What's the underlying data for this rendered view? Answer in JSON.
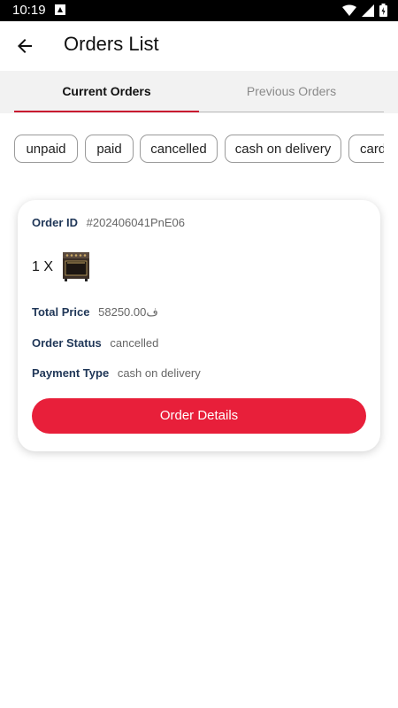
{
  "status_bar": {
    "time": "10:19"
  },
  "header": {
    "title": "Orders List"
  },
  "tabs": [
    {
      "label": "Current Orders",
      "active": true
    },
    {
      "label": "Previous Orders",
      "active": false
    }
  ],
  "filters": [
    "unpaid",
    "paid",
    "cancelled",
    "cash on delivery",
    "card"
  ],
  "order": {
    "id_label": "Order ID",
    "id_value": "#202406041PnE06",
    "quantity": "1 X",
    "total_label": "Total Price",
    "total_value": "58250.00ف",
    "status_label": "Order Status",
    "status_value": "cancelled",
    "payment_label": "Payment Type",
    "payment_value": "cash on delivery",
    "details_button": "Order Details"
  },
  "colors": {
    "accent": "#e81f3a",
    "tab_indicator": "#c8102e",
    "label_text": "#1f3657"
  }
}
